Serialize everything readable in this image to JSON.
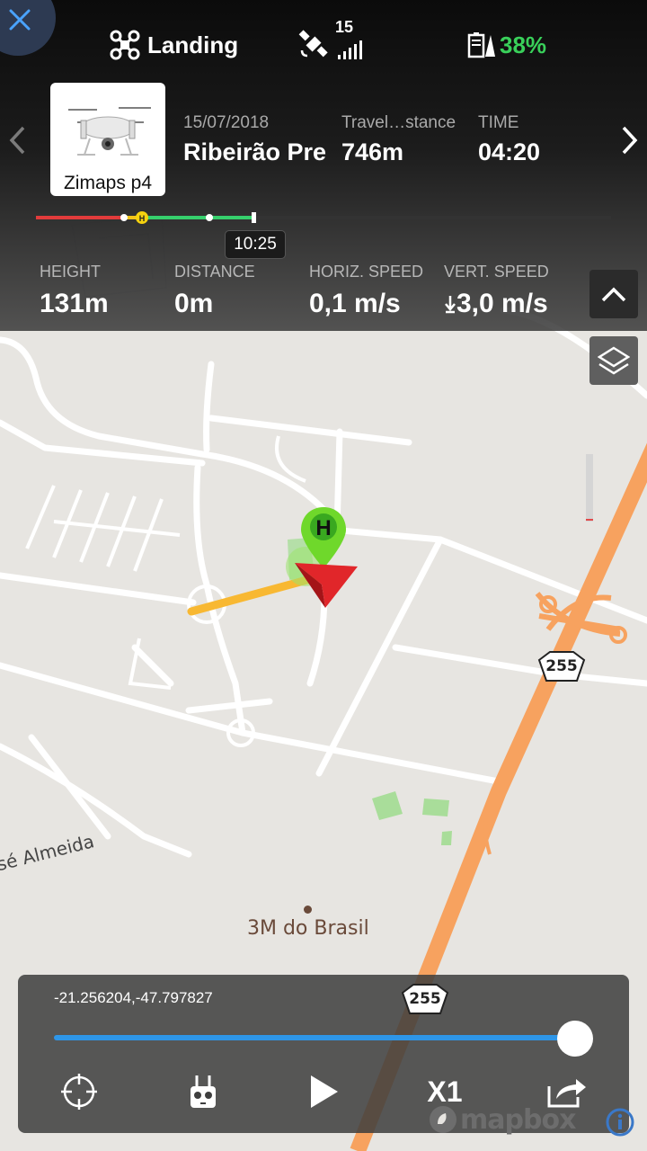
{
  "status_bar": {
    "mode_label": "Landing",
    "satellite_count": "15",
    "battery_percent": "38%",
    "battery_color": "#39d05a"
  },
  "flight": {
    "aircraft_name": "Zimaps p4",
    "date": "15/07/2018",
    "location": "Ribeirão Pre",
    "travel_label": "Travel…stance",
    "travel_value": "746m",
    "time_label": "TIME",
    "time_value": "04:20"
  },
  "timeline": {
    "current_time": "10:25",
    "progress": 0.38
  },
  "telemetry": {
    "height_label": "HEIGHT",
    "height_value": "131m",
    "distance_label": "DISTANCE",
    "distance_value": "0m",
    "hspeed_label": "HORIZ. SPEED",
    "hspeed_value": "0,1 m/s",
    "vspeed_label": "VERT. SPEED",
    "vspeed_value": "3,0 m/s"
  },
  "map": {
    "road_shield_1": "255",
    "road_shield_2": "255",
    "street_label": "sé Almeida",
    "poi_label": "3M do Brasil",
    "home_marker": "H",
    "attribution": "mapbox"
  },
  "playback": {
    "coordinates": "-21.256204,-47.797827",
    "progress": 0.95,
    "speed_label": "X1"
  },
  "icons": {
    "close": "close-icon",
    "drone": "drone-icon",
    "satellite": "satellite-icon",
    "battery": "battery-icon",
    "layers": "layers-icon",
    "collapse": "chevron-up-icon",
    "locate": "crosshair-icon",
    "remote": "remote-controller-icon",
    "play": "play-icon",
    "share": "share-icon",
    "info": "info-icon"
  }
}
